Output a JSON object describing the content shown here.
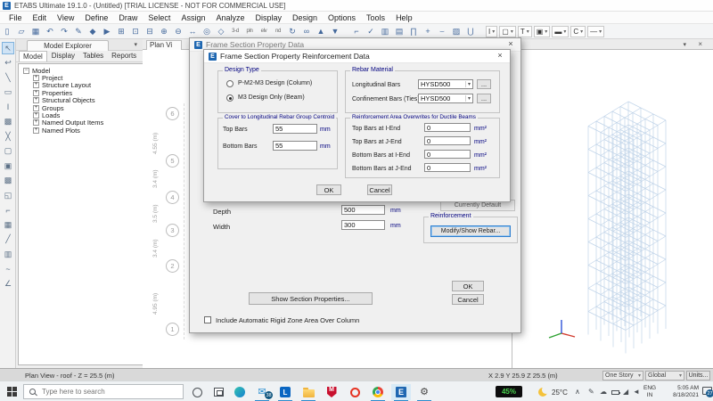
{
  "icons": {
    "caret": "▾",
    "close": "×",
    "tray_chevron": "∧",
    "tray_pen": "✎",
    "tray_cloud": "☁",
    "tray_signal": "◢",
    "tray_volume": "◄"
  },
  "app": {
    "title": "ETABS Ultimate 19.1.0 - (Untitled)  [TRIAL LICENSE - NOT FOR COMMERCIAL USE]"
  },
  "menubar": {
    "items": [
      "File",
      "Edit",
      "View",
      "Define",
      "Draw",
      "Select",
      "Assign",
      "Analyze",
      "Display",
      "Design",
      "Options",
      "Tools",
      "Help"
    ]
  },
  "toolbar": {
    "main_icons": [
      {
        "name": "new-model-icon",
        "glyph": "▯"
      },
      {
        "name": "open-model-icon",
        "glyph": "▱"
      },
      {
        "name": "save-model-icon",
        "glyph": "▦"
      },
      {
        "name": "undo-icon",
        "glyph": "↶"
      },
      {
        "name": "redo-icon",
        "glyph": "↷"
      },
      {
        "name": "edit-icon",
        "glyph": "✎"
      },
      {
        "name": "lock-model-icon",
        "glyph": "◆"
      },
      {
        "name": "run-analysis-icon",
        "glyph": "▶"
      },
      {
        "name": "rubber-band-zoom-icon",
        "glyph": "⊞"
      },
      {
        "name": "restore-full-view-icon",
        "glyph": "⊡"
      },
      {
        "name": "previous-zoom-icon",
        "glyph": "⊟"
      },
      {
        "name": "zoom-in-icon",
        "glyph": "⊕"
      },
      {
        "name": "zoom-out-icon",
        "glyph": "⊖"
      },
      {
        "name": "pan-icon",
        "glyph": "↔"
      },
      {
        "name": "orbit-icon",
        "glyph": "◎"
      },
      {
        "name": "perspective-icon",
        "glyph": "◇"
      },
      {
        "name": "view-3d-icon",
        "glyph": "3-d",
        "txt": true
      },
      {
        "name": "view-plan-icon",
        "glyph": "pln",
        "txt": true
      },
      {
        "name": "view-elevation-icon",
        "glyph": "elv",
        "txt": true
      },
      {
        "name": "view-named-icon",
        "glyph": "nd",
        "txt": true
      },
      {
        "name": "rotate-view-icon",
        "glyph": "↻"
      },
      {
        "name": "object-options-icon",
        "glyph": "∞"
      },
      {
        "name": "shift-story-up-icon",
        "glyph": "▲"
      },
      {
        "name": "shift-story-down-icon",
        "glyph": "▼"
      }
    ],
    "group2_icons": [
      {
        "name": "show-grid-icon",
        "glyph": "⌐"
      },
      {
        "name": "check-model-icon",
        "glyph": "✓"
      },
      {
        "name": "wall-view-icon",
        "glyph": "▥"
      },
      {
        "name": "floor-view-icon",
        "glyph": "▤"
      },
      {
        "name": "frame-elevation-icon",
        "glyph": "∏"
      },
      {
        "name": "add-object-icon",
        "glyph": "+"
      },
      {
        "name": "draw-arc-icon",
        "glyph": "⌣"
      },
      {
        "name": "mesh-view-icon",
        "glyph": "▨"
      },
      {
        "name": "section-cut-icon",
        "glyph": "⋃"
      }
    ],
    "section_buttons": [
      {
        "name": "i-section-button",
        "label": "I"
      },
      {
        "name": "rect-section-button",
        "label": "▢"
      },
      {
        "name": "t-section-button",
        "label": "T"
      },
      {
        "name": "box-section-button",
        "label": "▣"
      },
      {
        "name": "channel-section-button",
        "label": "▬"
      },
      {
        "name": "c-section-button",
        "label": "C"
      },
      {
        "name": "line-section-button",
        "label": "—"
      }
    ]
  },
  "side_toolbar": {
    "icons": [
      {
        "name": "select-pointer-icon",
        "glyph": "↖"
      },
      {
        "name": "reshape-icon",
        "glyph": "↩"
      },
      {
        "name": "draw-joint-icon",
        "glyph": "╲"
      },
      {
        "name": "draw-frame-icon",
        "glyph": "▭"
      },
      {
        "name": "quick-draw-beam-icon",
        "glyph": "I"
      },
      {
        "name": "quick-draw-braces-icon",
        "glyph": "▩"
      },
      {
        "name": "quick-draw-columns-icon",
        "glyph": "╳"
      },
      {
        "name": "draw-floor-icon",
        "glyph": "▢"
      },
      {
        "name": "draw-wall-icon",
        "glyph": "▣"
      },
      {
        "name": "quick-draw-areas-icon",
        "glyph": "▩"
      },
      {
        "name": "draw-rect-area-icon",
        "glyph": "◱"
      },
      {
        "name": "draw-links-icon",
        "glyph": "⌐"
      },
      {
        "name": "draw-grid-icon",
        "glyph": "▦"
      },
      {
        "name": "draw-line-icon",
        "glyph": "╱"
      },
      {
        "name": "draw-wall-stack-icon",
        "glyph": "▥"
      },
      {
        "name": "draw-tendon-icon",
        "glyph": "~"
      },
      {
        "name": "measure-angle-icon",
        "glyph": "∠"
      }
    ]
  },
  "model_explorer": {
    "title": "Model Explorer",
    "tabs": [
      "Model",
      "Display",
      "Tables",
      "Reports"
    ],
    "root": "Model",
    "items": [
      "Project",
      "Structure Layout",
      "Properties",
      "Structural Objects",
      "Groups",
      "Loads",
      "Named Output Items",
      "Named Plots"
    ]
  },
  "plan_view": {
    "tab": "Plan Vi",
    "grid_bubbles": [
      "6",
      "5",
      "4",
      "3",
      "2",
      "1"
    ],
    "dim_labels": [
      "4.55 (m)",
      "3.4 (m)",
      "3.5 (m)",
      "3.4 (m)",
      "4.95 (m)"
    ]
  },
  "dialog_back": {
    "title": "Frame Section Property Data",
    "currently_default": "Currently Default",
    "reinforcement_title": "Reinforcement",
    "modify_show_rebar": "Modify/Show Rebar...",
    "rows": [
      {
        "label": "Depth",
        "value": "500",
        "unit": "mm"
      },
      {
        "label": "Width",
        "value": "300",
        "unit": "mm"
      }
    ],
    "show_section_properties": "Show Section Properties...",
    "rigid_zone_label": "Include Automatic Rigid Zone Area Over Column",
    "ok": "OK",
    "cancel": "Cancel"
  },
  "dialog_front": {
    "title": "Frame Section Property Reinforcement Data",
    "design_type": {
      "title": "Design Type",
      "option_column": "P-M2-M3 Design  (Column)",
      "option_beam": "M3 Design Only  (Beam)"
    },
    "rebar_material": {
      "title": "Rebar Material",
      "longitudinal_label": "Longitudinal Bars",
      "longitudinal_value": "HYSD500",
      "confinement_label": "Confinement Bars (Ties)",
      "confinement_value": "HYSD500",
      "browse": "..."
    },
    "cover": {
      "title": "Cover to Longitudinal Rebar Group Centroid",
      "rows": [
        {
          "label": "Top Bars",
          "value": "55",
          "unit": "mm"
        },
        {
          "label": "Bottom  Bars",
          "value": "55",
          "unit": "mm"
        }
      ]
    },
    "overwrites": {
      "title": "Reinforcement Area Overwrites for Ductile Beams",
      "rows": [
        {
          "label": "Top Bars at I-End",
          "value": "0",
          "unit": "mm²"
        },
        {
          "label": "Top Bars at J-End",
          "value": "0",
          "unit": "mm²"
        },
        {
          "label": "Bottom Bars at I-End",
          "value": "0",
          "unit": "mm²"
        },
        {
          "label": "Bottom Bars at J-End",
          "value": "0",
          "unit": "mm²"
        }
      ]
    },
    "ok": "OK",
    "cancel": "Cancel"
  },
  "statusbar": {
    "view_info": "Plan View - roof - Z = 25.5 (m)",
    "cursor_coords": "X 2.9  Y 25.9  Z 25.5 (m)",
    "story_mode": "One Story",
    "coord_system": "Global",
    "units_button": "Units..."
  },
  "taskbar": {
    "search_placeholder": "Type here to search",
    "mail_badge": "38",
    "letter_app_label": "L",
    "mcafee_label": "M",
    "etabs_label": "E",
    "battery_text": "45%",
    "temperature": "25°C",
    "lang_line1": "ENG",
    "lang_line2": "IN",
    "time": "5:05 AM",
    "date": "8/18/2021",
    "notification_badge": "27"
  }
}
